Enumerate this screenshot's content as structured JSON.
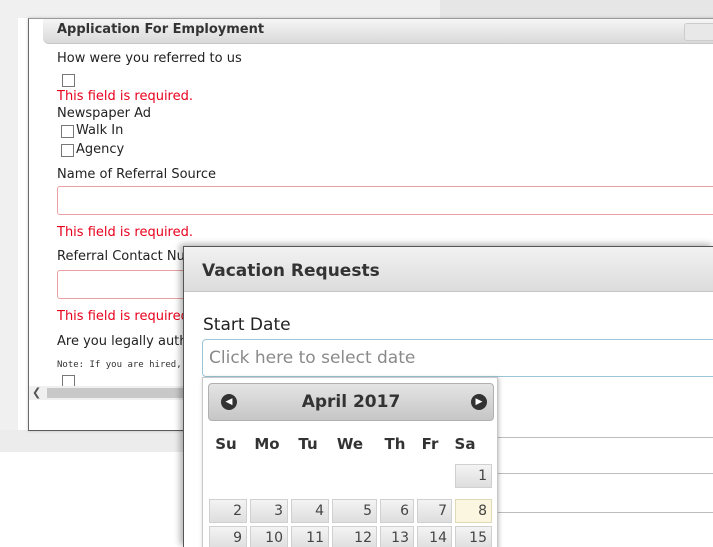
{
  "application": {
    "title": "Application For Employment",
    "referred_question": "How were you referred to us",
    "required_msg": "This field is required.",
    "referral_options": [
      "Newspaper Ad",
      "Walk In",
      "Agency"
    ],
    "referral_source_label": "Name of Referral Source",
    "referral_contact_label": "Referral Contact Number",
    "legally_auth_label": "Are you legally authorized to work in the United States?",
    "note": "Note: If you are hired, you will be required to provide proof of eligibility.",
    "scroll_left_icon": "chevron-left"
  },
  "vacation": {
    "title": "Vacation Requests",
    "start_date_label": "Start Date",
    "start_date_placeholder": "Click here to select date",
    "datepicker": {
      "month_label": "April 2017",
      "prev_icon": "prev-circle-icon",
      "next_icon": "next-circle-icon",
      "weekdays": [
        "Su",
        "Mo",
        "Tu",
        "We",
        "Th",
        "Fr",
        "Sa"
      ],
      "row1": [
        "1"
      ],
      "row2": [
        "2",
        "3",
        "4",
        "5",
        "6",
        "7",
        "8"
      ],
      "row3": [
        "9",
        "10",
        "11",
        "12",
        "13",
        "14",
        "15"
      ],
      "today": "8"
    }
  }
}
